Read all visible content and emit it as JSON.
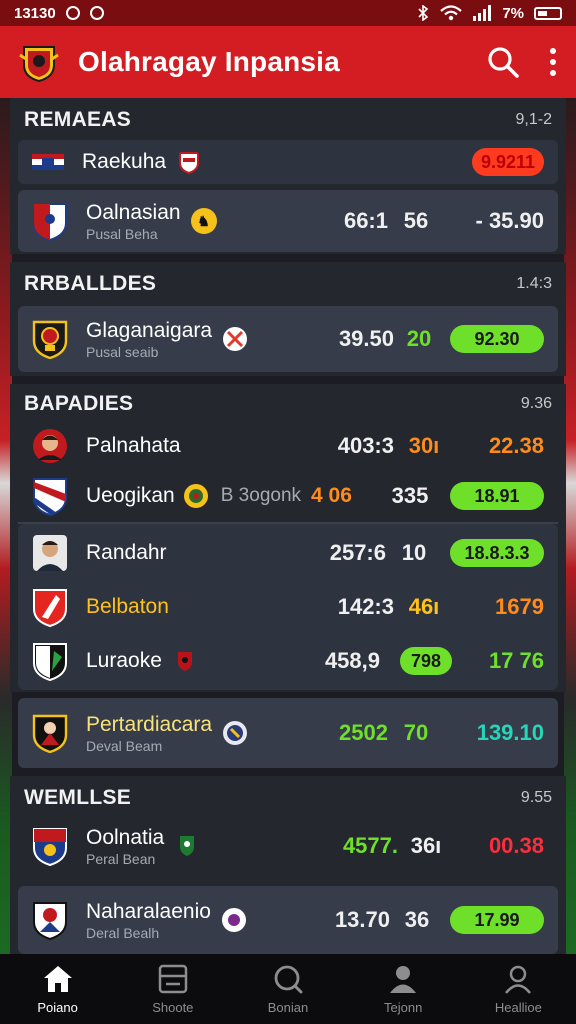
{
  "status": {
    "time": "13130",
    "battery": "7%"
  },
  "app": {
    "title": "Olahragay Inpansia"
  },
  "sections": [
    {
      "title": "REMAEAS",
      "meta": "9,1-2",
      "rows": [
        {
          "name": "Raekuha",
          "sub": "",
          "score": "",
          "num": "",
          "odds": "9.9211",
          "odds_style": "red-pill"
        },
        {
          "name": "Oalnasian",
          "sub": "Pusal Beha",
          "score": "66:1",
          "num": "56",
          "odds": "- 35.90",
          "odds_style": "plain"
        }
      ]
    },
    {
      "title": "RRBALLDES",
      "meta": "1.4:3",
      "rows": [
        {
          "name": "Glaganaigara",
          "sub": "Pusal seaib",
          "score": "39.50",
          "num": "20",
          "odds": "92.30",
          "odds_style": "green-pill"
        }
      ]
    },
    {
      "title": "BAPADIES",
      "meta": "9.36",
      "rows": [
        {
          "name": "Palnahata",
          "sub": "",
          "score": "403:3",
          "num": "30ı",
          "odds": "22.38",
          "odds_style": "orange"
        },
        {
          "name": "Ueogikan",
          "sub": "",
          "extra": "B 3ogonk",
          "extra_num": "4 06",
          "score": "",
          "num": "335",
          "odds": "18.91",
          "odds_style": "green-pill"
        },
        {
          "name": "Randahr",
          "sub": "",
          "score": "257:6",
          "num": "10",
          "odds": "18.8.3.3",
          "odds_style": "green-pill"
        },
        {
          "name": "Belbaton",
          "sub": "",
          "score": "142:3",
          "num": "46ı",
          "odds": "1679",
          "odds_style": "yellow"
        },
        {
          "name": "Luraoke",
          "sub": "",
          "score": "458,9",
          "num": "798",
          "odds": "17 76",
          "odds_style": "green"
        }
      ]
    },
    {
      "title": "",
      "meta": "",
      "rows": [
        {
          "name": "Pertardiacara",
          "sub": "Deval Beam",
          "score": "2502",
          "num": "70",
          "odds": "139.10",
          "odds_style": "teal"
        }
      ]
    },
    {
      "title": "WEMLLSE",
      "meta": "9.55",
      "rows": [
        {
          "name": "Oolnatia",
          "sub": "Peral Bean",
          "score": "4577.",
          "num": "36ı",
          "odds": "00.38",
          "odds_style": "red"
        },
        {
          "name": "Naharalaenio",
          "sub": "Deral Bealh",
          "score": "13.70",
          "num": "36",
          "odds": "17.99",
          "odds_style": "green-pill"
        }
      ]
    }
  ],
  "nav": [
    {
      "label": "Poiano",
      "icon": "home-icon"
    },
    {
      "label": "Shoote",
      "icon": "card-icon"
    },
    {
      "label": "Bonian",
      "icon": "search-icon"
    },
    {
      "label": "Tejonn",
      "icon": "user-icon"
    },
    {
      "label": "Heallioe",
      "icon": "profile-icon"
    }
  ],
  "colors": {
    "accent": "#d31d22",
    "positive": "#6fe02a",
    "warning": "#ff8c1a",
    "negative": "#ff2d3b"
  }
}
